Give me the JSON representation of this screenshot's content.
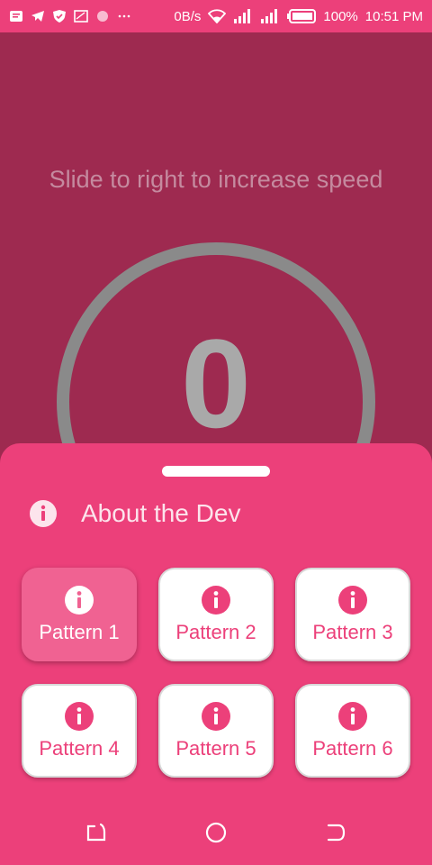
{
  "status_bar": {
    "net_speed": "0B/s",
    "battery": "100%",
    "time": "10:51 PM",
    "icons": [
      "message-icon",
      "telegram-icon",
      "shield-icon",
      "cast-icon",
      "record-icon",
      "more-icon",
      "wifi-icon",
      "signal-icon",
      "signal-icon",
      "battery-icon"
    ]
  },
  "main": {
    "hint": "Slide to right to increase speed",
    "speed": "0"
  },
  "sheet": {
    "about_label": "About the Dev",
    "patterns": [
      {
        "label": "Pattern 1",
        "selected": true
      },
      {
        "label": "Pattern 2",
        "selected": false
      },
      {
        "label": "Pattern 3",
        "selected": false
      },
      {
        "label": "Pattern 4",
        "selected": false
      },
      {
        "label": "Pattern 5",
        "selected": false
      },
      {
        "label": "Pattern 6",
        "selected": false
      }
    ]
  },
  "navbar": {
    "buttons": [
      "recents-icon",
      "home-icon",
      "back-icon"
    ]
  },
  "colors": {
    "accent": "#ec407a",
    "selected_pattern": "#f06292",
    "background": "#9e2a50",
    "dial_ring": "#8a8a8a"
  }
}
